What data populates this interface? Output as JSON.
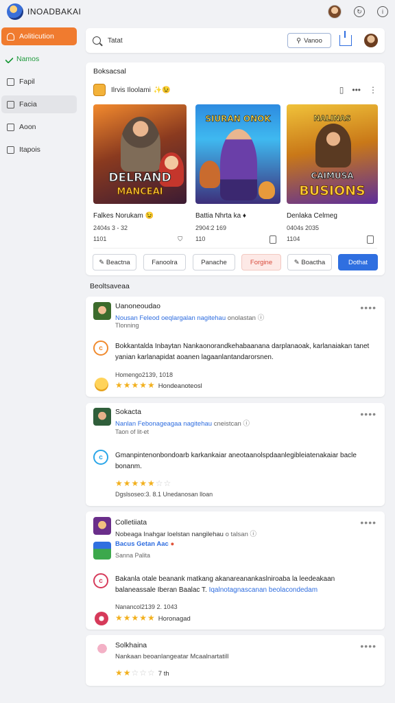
{
  "app": {
    "title": "INOADBAKAI"
  },
  "sidebar": {
    "items": [
      {
        "label": "Aoliticution"
      },
      {
        "label": "Namos"
      },
      {
        "label": "Fapil"
      },
      {
        "label": "Facia"
      },
      {
        "label": "Aoon"
      },
      {
        "label": "Itapois"
      }
    ]
  },
  "search": {
    "value": "Tatat",
    "button_label": "Vanoo"
  },
  "featured": {
    "section_title": "Boksacsal",
    "label": "Ilrvis Iloolami",
    "games": [
      {
        "title_art": "DELRAND",
        "subtitle_art": "MANCEAI",
        "name": "Falkes Norukam",
        "meta": "2404s 3 - 32",
        "sub": "1101"
      },
      {
        "title_art": "SIURAN ONOK",
        "name": "Battia Nhrta ka",
        "meta": "2904:2 169",
        "sub": "110"
      },
      {
        "title_art": "NALINAS",
        "subtitle_art": "CAIMUSA",
        "banner_art": "BUSIONS",
        "name": "Denlaka Celmeg",
        "meta": "0404s 2035",
        "sub": "1104"
      }
    ],
    "actions": [
      "Beactna",
      "Fanoolra",
      "Panache",
      "Forgine",
      "Boactha",
      "Dothat"
    ]
  },
  "reviews": {
    "section_title": "Beoltsaveaa",
    "items": [
      {
        "name": "Uanoneoudao",
        "sub_link": "Nousan Feleod oeqlargalan nagitehau",
        "sub_tail": "onolastan",
        "meta": "Tlonning",
        "badge_letter": "c",
        "text": "Bokkantalda Inbaytan Nankaonorandkehabaanana darplanaoak, karlanaiakan tanet yanian karlanapidat aoanen lagaanlantandarorsnen.",
        "date": "Homengo2139, 1018",
        "stars": "★★★★★",
        "stars_off": "",
        "stars_label": "Hondeanoteosl"
      },
      {
        "name": "Sokacta",
        "sub_link": "Nanlan Febonageagaa nagitehau",
        "sub_tail": "cneistcan",
        "meta": "Taon of lit-et",
        "badge_letter": "c",
        "text": "Gmanpintenonbondoarb karkankaiar aneotaanolspdaanlegibleiatenakaiar bacle bonanm.",
        "date": "Dgslsoseo:3. 8.1 Unedanosan lloan",
        "stars": "★★★★★",
        "stars_off": "☆☆",
        "stars_label": ""
      },
      {
        "name": "Colletiiata",
        "sub_link": "Nobeaga Inahgar loelstan nangilehau",
        "sub_tail": "o talsan",
        "sub2": "Bacus Getan Aac",
        "meta": "Sanna Palita",
        "badge_letter": "c",
        "text": "Bakanla otale beanank matkang akanareanankaslniroaba la leedeakaan balaneassale Iberan Baalac T.",
        "text_link": "Iqalnotagnascanan beolacondedam",
        "date": "Nanancol2139 2. 1043",
        "stars": "★★★★★",
        "stars_off": "",
        "stars_label": "Horonagad"
      },
      {
        "name": "Solkhaina",
        "sub_plain": "Nankaan beoanlangeatar Mcaalnartatill",
        "stars": "★★",
        "stars_off": "☆☆☆",
        "stars_label": "7 th"
      }
    ]
  },
  "colors": {
    "accent": "#f07b2f",
    "primary": "#2f6fe0",
    "link": "#2d6cdf",
    "star": "#f2b01e"
  },
  "icons": [
    "logo-icon",
    "avatar-icon",
    "refresh-icon",
    "info-icon",
    "search-icon",
    "share-icon",
    "more-icon",
    "copy-icon",
    "star-icon"
  ]
}
